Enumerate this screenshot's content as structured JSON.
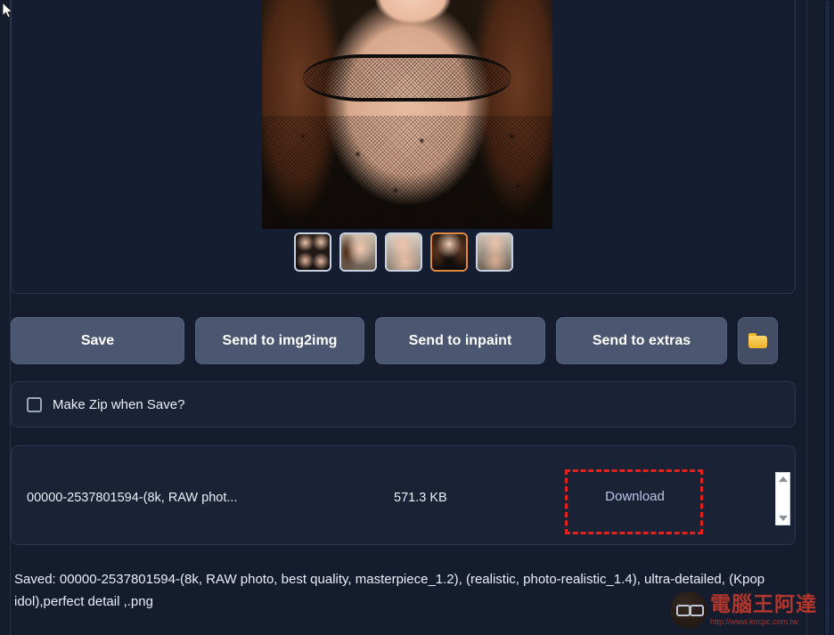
{
  "theme": {
    "background": "#141c2e",
    "panel_background": "#1a2336",
    "panel_border": "#2b3650",
    "button_background": "#4b5670",
    "text_primary": "#e9eef7",
    "link_color": "#b9c5e2",
    "highlight_color": "#e2211c",
    "thumb_selected_border": "#e0893a",
    "folder_icon_color": "#f0b429"
  },
  "gallery": {
    "main_image_alt": "generated-portrait",
    "thumbnails": [
      {
        "name": "thumbnail-1",
        "selected": false
      },
      {
        "name": "thumbnail-2",
        "selected": false
      },
      {
        "name": "thumbnail-3",
        "selected": false
      },
      {
        "name": "thumbnail-4",
        "selected": true
      },
      {
        "name": "thumbnail-5",
        "selected": false
      }
    ],
    "selected_index": 4
  },
  "toolbar": {
    "save_label": "Save",
    "send_img2img_label": "Send to img2img",
    "send_inpaint_label": "Send to inpaint",
    "send_extras_label": "Send to extras",
    "open_folder_icon": "folder-icon"
  },
  "options": {
    "make_zip_label": "Make Zip when Save?",
    "make_zip_checked": false
  },
  "file": {
    "name": "00000-2537801594-(8k, RAW phot...",
    "size": "571.3 KB",
    "download_label": "Download"
  },
  "scrollbar": {
    "up_icon": "triangle-up-icon",
    "down_icon": "triangle-down-icon"
  },
  "status": {
    "saved_text": "Saved: 00000-2537801594-(8k, RAW photo, best quality, masterpiece_1.2), (realistic, photo-realistic_1.4), ultra-detailed, (Kpop idol),perfect detail ,.png"
  },
  "watermark": {
    "name": "電腦王阿達",
    "url": "http://www.kocpc.com.tw"
  }
}
